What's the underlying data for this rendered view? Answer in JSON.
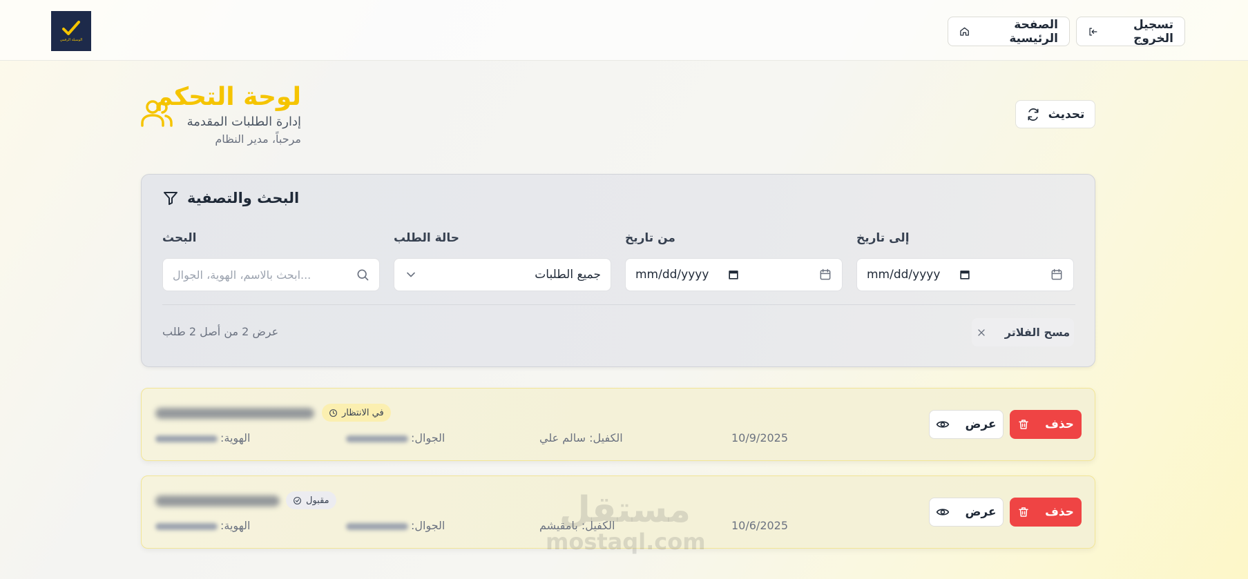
{
  "header": {
    "logo_text": "الوسيلة الرقمي",
    "logout_label": "تسجيل الخروج",
    "home_label": "الصفحة الرئيسية"
  },
  "dashboard": {
    "title": "لوحة التحكم",
    "subtitle": "إدارة الطلبات المقدمة",
    "welcome": "مرحباً، مدير النظام",
    "refresh_label": "تحديث"
  },
  "filters": {
    "title": "البحث والتصفية",
    "search_label": "البحث",
    "search_placeholder": "...ابحث بالاسم، الهوية، الجوال",
    "status_label": "حالة الطلب",
    "status_value": "جميع الطلبات",
    "from_label": "من تاريخ",
    "from_value": "mm/dd/yyyy",
    "to_label": "إلى تاريخ",
    "to_value": "mm/dd/yyyy",
    "count_text": "عرض 2 من أصل 2 طلب",
    "clear_label": "مسح الفلاتر"
  },
  "requests": [
    {
      "status": "في الانتظار",
      "id_label": "الهوية:",
      "phone_label": "الجوال:",
      "sponsor": "الكفيل: سالم علي",
      "date": "10/9/2025",
      "view_label": "عرض",
      "delete_label": "حذف"
    },
    {
      "status": "مقبول",
      "id_label": "الهوية:",
      "phone_label": "الجوال:",
      "sponsor": "الكفيل: بامقيشم",
      "date": "10/6/2025",
      "view_label": "عرض",
      "delete_label": "حذف"
    }
  ],
  "watermark": {
    "ar": "مستقل",
    "en": "mostaql.com"
  },
  "colors": {
    "accent": "#f5c400",
    "danger": "#ef4444",
    "logo_bg": "#1d2a4a"
  }
}
